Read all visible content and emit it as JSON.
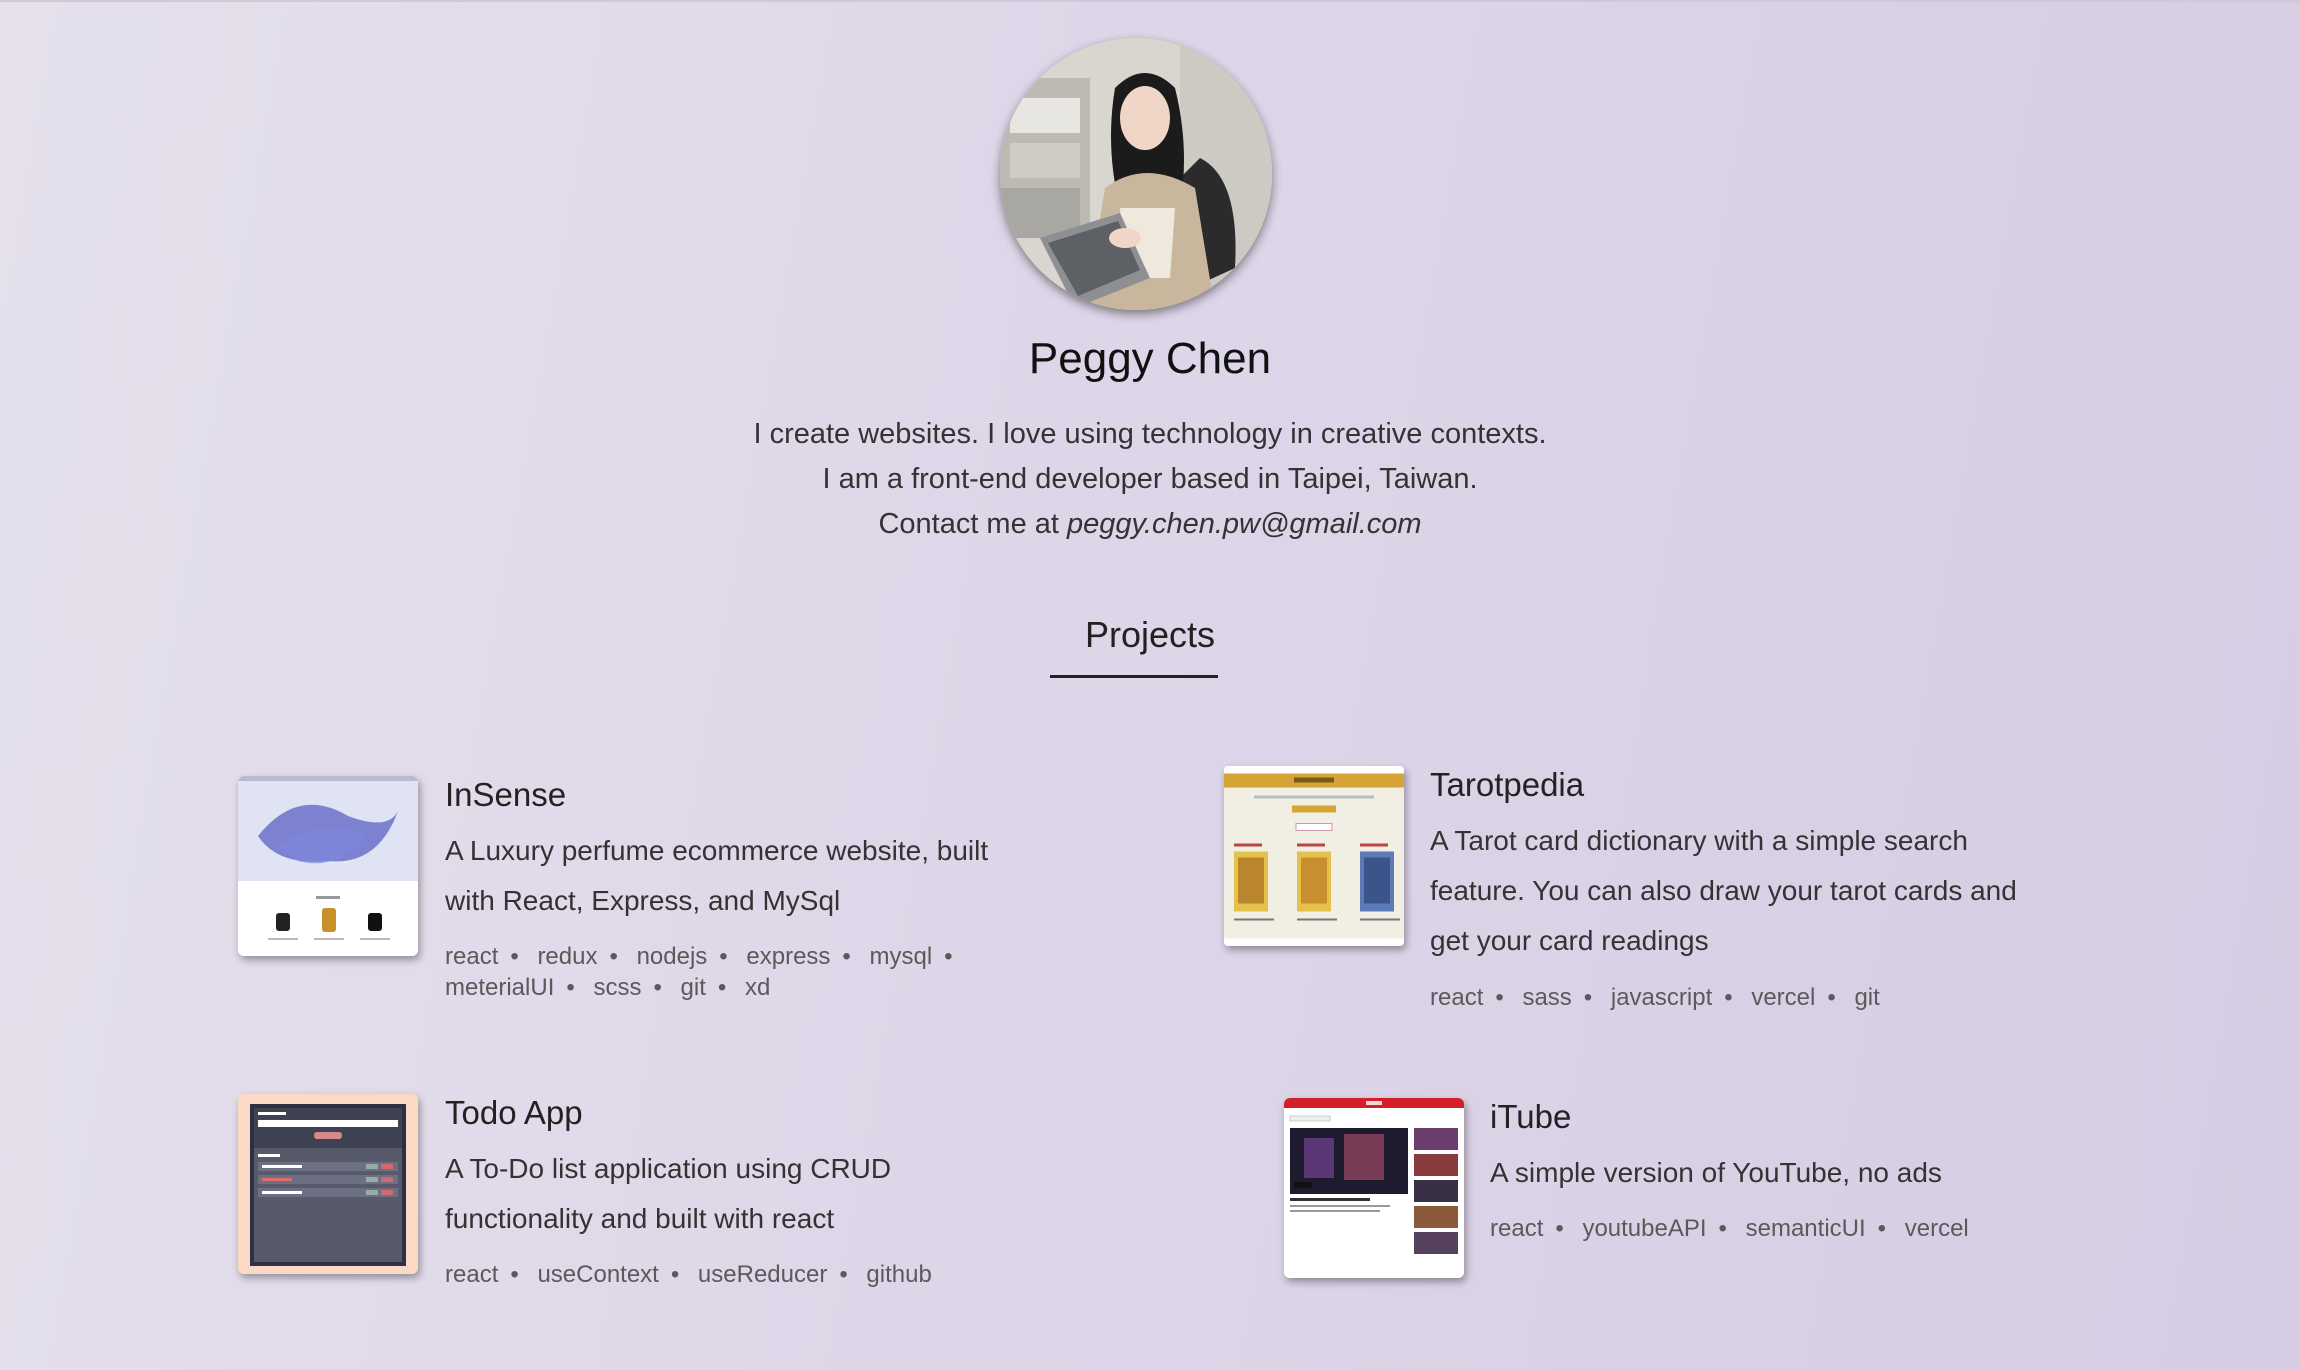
{
  "profile": {
    "name": "Peggy Chen",
    "bio_line1": "I create websites. I love using technology in creative contexts.",
    "bio_line2": "I am a front-end developer based in Taipei, Taiwan.",
    "contact_prefix": "Contact me at ",
    "contact_email": "peggy.chen.pw@gmail.com"
  },
  "projects_section": {
    "title": "Projects"
  },
  "projects": [
    {
      "title": "InSense",
      "description": "A Luxury perfume ecommerce website, built with React, Express, and MySql",
      "tags": [
        "react",
        "redux",
        "nodejs",
        "express",
        "mysql",
        "meterialUI",
        "scss",
        "git",
        "xd"
      ]
    },
    {
      "title": "Tarotpedia",
      "description": "A Tarot card dictionary with a simple search feature. You can also draw your tarot cards and get your card readings",
      "tags": [
        "react",
        "sass",
        "javascript",
        "vercel",
        "git"
      ]
    },
    {
      "title": "Todo App",
      "description": "A To-Do list application using CRUD functionality and built with react",
      "tags": [
        "react",
        "useContext",
        "useReducer",
        "github"
      ]
    },
    {
      "title": "iTube",
      "description": "A simple version of YouTube, no ads",
      "tags": [
        "react",
        "youtubeAPI",
        "semanticUI",
        "vercel"
      ]
    }
  ]
}
